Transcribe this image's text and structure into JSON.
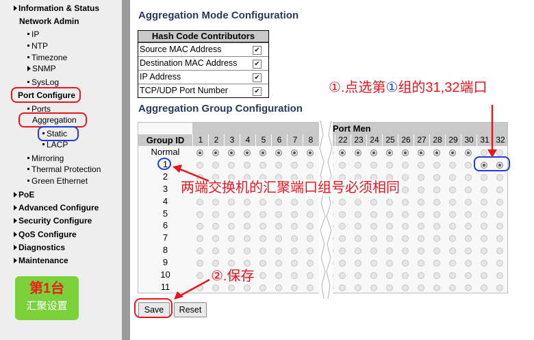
{
  "sidebar": {
    "information_status": "Information & Status",
    "network_admin": "Network Admin",
    "ip": "IP",
    "ntp": "NTP",
    "timezone": "Timezone",
    "snmp": "SNMP",
    "syslog": "SysLog",
    "port_configure": "Port Configure",
    "ports": "Ports",
    "aggregation": "Aggregation",
    "static": "Static",
    "lacp": "LACP",
    "mirroring": "Mirroring",
    "thermal": "Thermal Protection",
    "green": "Green Ethernet",
    "poe": "PoE",
    "advanced": "Advanced Configure",
    "security": "Security Configure",
    "qos": "QoS Configure",
    "diagnostics": "Diagnostics",
    "maintenance": "Maintenance"
  },
  "badge": {
    "line1": "第1台",
    "line2": "汇聚设置"
  },
  "mode": {
    "title": "Aggregation Mode Configuration",
    "table_title": "Hash Code Contributors",
    "rows": [
      {
        "label": "Source MAC Address",
        "checked": true
      },
      {
        "label": "Destination MAC Address",
        "checked": true
      },
      {
        "label": "IP Address",
        "checked": true
      },
      {
        "label": "TCP/UDP Port Number",
        "checked": true
      }
    ]
  },
  "group": {
    "title": "Aggregation Group Configuration",
    "port_members_header": "Port Men",
    "group_id_header": "Group ID",
    "left_ports": [
      "1",
      "2",
      "3",
      "4",
      "5",
      "6",
      "7",
      "8"
    ],
    "right_ports": [
      "22",
      "23",
      "24",
      "25",
      "26",
      "27",
      "28",
      "29",
      "30",
      "31",
      "32"
    ],
    "rows": [
      "Normal",
      "1",
      "2",
      "3",
      "4",
      "5",
      "6",
      "7",
      "8",
      "9",
      "10",
      "11"
    ]
  },
  "buttons": {
    "save": "Save",
    "reset": "Reset"
  },
  "annotations": {
    "step1_a": "①.点选第",
    "step1_b": "①",
    "step1_c": "组的31,32端口",
    "center": "两端交换机的汇聚端口组号必须相同",
    "step2": "②.保存"
  },
  "colors": {
    "red": "#e8151c",
    "blue": "#1c3ce0",
    "badge": "#7ad13a"
  }
}
